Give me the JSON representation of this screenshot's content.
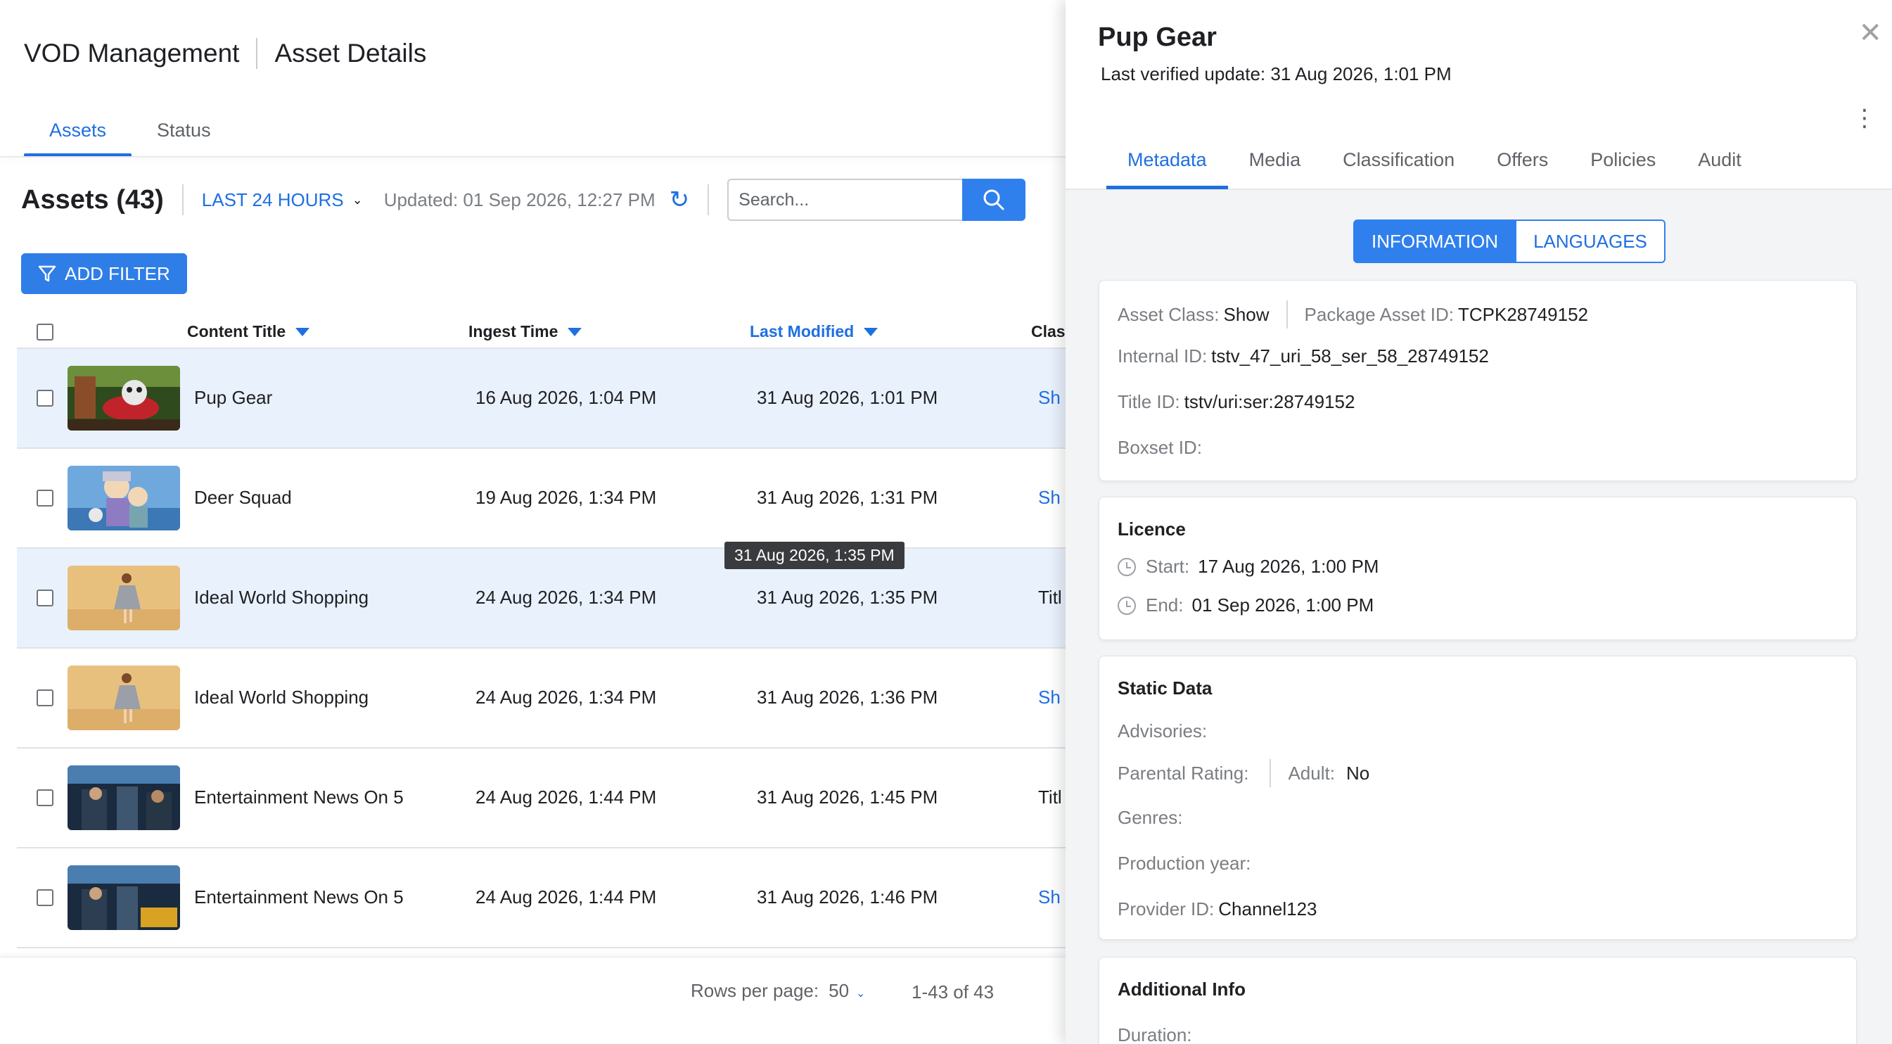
{
  "header": {
    "app_title": "VOD Management",
    "page_title": "Asset Details"
  },
  "nav": {
    "tabs": [
      "Assets",
      "Status"
    ]
  },
  "toolbar": {
    "assets_title": "Assets (43)",
    "range": "LAST 24 HOURS",
    "updated": "Updated: 01 Sep 2026, 12:27 PM",
    "search_placeholder": "Search..."
  },
  "filter": {
    "label": "ADD FILTER"
  },
  "table": {
    "columns": [
      "Content Title",
      "Ingest Time",
      "Last Modified",
      "Class"
    ],
    "rows": [
      {
        "title": "Pup Gear",
        "ingest": "16 Aug 2026, 1:04 PM",
        "modified": "31 Aug 2026, 1:01 PM",
        "class": "Sh"
      },
      {
        "title": "Deer Squad",
        "ingest": "19 Aug 2026, 1:34 PM",
        "modified": "31 Aug 2026, 1:31 PM",
        "class": "Sh"
      },
      {
        "title": "Ideal World Shopping",
        "ingest": "24 Aug 2026, 1:34 PM",
        "modified": "31 Aug 2026, 1:35 PM",
        "class": "Titl"
      },
      {
        "title": "Ideal World Shopping",
        "ingest": "24 Aug 2026, 1:34 PM",
        "modified": "31 Aug 2026, 1:36 PM",
        "class": "Sh"
      },
      {
        "title": "Entertainment News On 5",
        "ingest": "24 Aug 2026, 1:44 PM",
        "modified": "31 Aug 2026, 1:45 PM",
        "class": "Titl"
      },
      {
        "title": "Entertainment News On 5",
        "ingest": "24 Aug 2026, 1:44 PM",
        "modified": "31 Aug 2026, 1:46 PM",
        "class": "Sh"
      }
    ]
  },
  "tooltip": "31 Aug 2026, 1:35 PM",
  "footer": {
    "rows_per_page_label": "Rows per page:",
    "rows_per_page_value": "50",
    "page_info": "1-43 of 43"
  },
  "drawer": {
    "title": "Pup Gear",
    "subtitle": "Last verified update: 31 Aug 2026, 1:01 PM",
    "tabs": [
      "Metadata",
      "Media",
      "Classification",
      "Offers",
      "Policies",
      "Audit"
    ],
    "segments": [
      "INFORMATION",
      "LANGUAGES"
    ],
    "info": {
      "asset_class_label": "Asset Class:",
      "asset_class": "Show",
      "package_id_label": "Package Asset ID:",
      "package_id": "TCPK28749152",
      "internal_id_label": "Internal ID:",
      "internal_id": "tstv_47_uri_58_ser_58_28749152",
      "title_id_label": "Title ID:",
      "title_id": "tstv/uri:ser:28749152",
      "boxset_label": "Boxset ID:"
    },
    "licence": {
      "title": "Licence",
      "start_label": "Start:",
      "start": "17 Aug 2026, 1:00 PM",
      "end_label": "End:",
      "end": "01 Sep 2026, 1:00 PM"
    },
    "static": {
      "title": "Static Data",
      "advisories_label": "Advisories:",
      "parental_label": "Parental Rating:",
      "adult_label": "Adult:",
      "adult": "No",
      "genres_label": "Genres:",
      "year_label": "Production year:",
      "provider_label": "Provider ID:",
      "provider": "Channel123"
    },
    "additional": {
      "title": "Additional Info",
      "duration_label": "Duration:"
    }
  },
  "colors": {
    "accent": "#1f6fe0",
    "button": "#2f80ed",
    "row_selected": "#e9f1fd"
  }
}
